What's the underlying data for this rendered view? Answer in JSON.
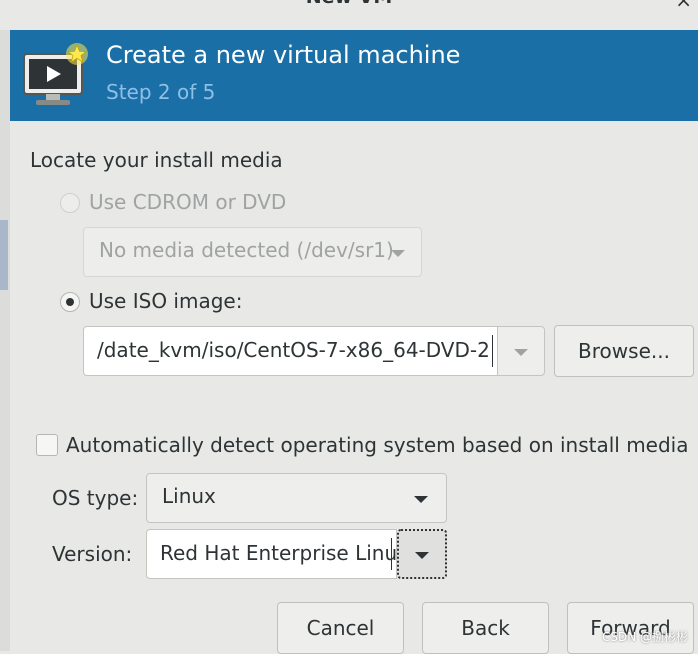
{
  "window": {
    "title": "New VM",
    "close_glyph": "×"
  },
  "header": {
    "title": "Create a new virtual machine",
    "step": "Step 2 of 5",
    "icon": "monitor-new-icon",
    "bg_color": "#1a6fa6"
  },
  "media": {
    "section_label": "Locate your install media",
    "cdrom_option": {
      "label": "Use CDROM or DVD",
      "selected": false,
      "enabled": false
    },
    "cdrom_device": {
      "value": "No media detected (/dev/sr1)",
      "enabled": false
    },
    "iso_option": {
      "label": "Use ISO image:",
      "selected": true,
      "enabled": true
    },
    "iso_path": {
      "value": "/date_kvm/iso/CentOS-7-x86_64-DVD-2"
    },
    "browse_button": "Browse..."
  },
  "os": {
    "auto_detect": {
      "label": "Automatically detect operating system based on install media",
      "checked": false
    },
    "type_label": "OS type:",
    "type_value": "Linux",
    "version_label": "Version:",
    "version_value": "Red Hat Enterprise Linu"
  },
  "footer": {
    "cancel_button": "Cancel",
    "back_button": "Back",
    "forward_button": "Forward"
  },
  "watermark": "CSDN @捌彬彬"
}
